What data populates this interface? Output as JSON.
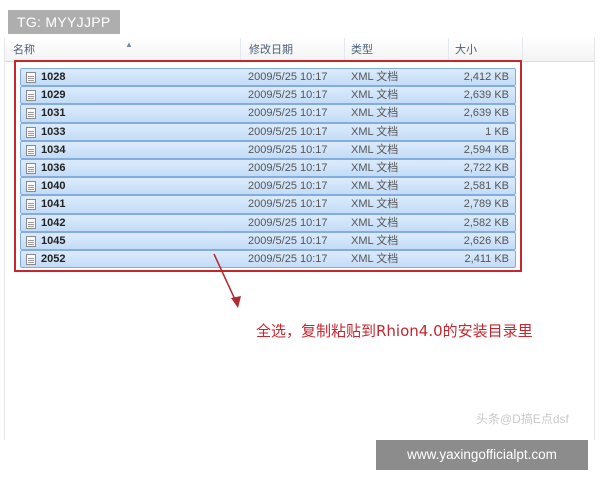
{
  "watermarks": {
    "top_left": "TG: MYYJJPP",
    "bottom_right": "www.yaxingofficialpt.com",
    "credit": "头条@D搞E点dsf"
  },
  "columns": {
    "name": "名称",
    "date": "修改日期",
    "type": "类型",
    "size": "大小"
  },
  "files": [
    {
      "name": "1028",
      "date": "2009/5/25 10:17",
      "type": "XML 文档",
      "size": "2,412 KB"
    },
    {
      "name": "1029",
      "date": "2009/5/25 10:17",
      "type": "XML 文档",
      "size": "2,639 KB"
    },
    {
      "name": "1031",
      "date": "2009/5/25 10:17",
      "type": "XML 文档",
      "size": "2,639 KB"
    },
    {
      "name": "1033",
      "date": "2009/5/25 10:17",
      "type": "XML 文档",
      "size": "1 KB"
    },
    {
      "name": "1034",
      "date": "2009/5/25 10:17",
      "type": "XML 文档",
      "size": "2,594 KB"
    },
    {
      "name": "1036",
      "date": "2009/5/25 10:17",
      "type": "XML 文档",
      "size": "2,722 KB"
    },
    {
      "name": "1040",
      "date": "2009/5/25 10:17",
      "type": "XML 文档",
      "size": "2,581 KB"
    },
    {
      "name": "1041",
      "date": "2009/5/25 10:17",
      "type": "XML 文档",
      "size": "2,789 KB"
    },
    {
      "name": "1042",
      "date": "2009/5/25 10:17",
      "type": "XML 文档",
      "size": "2,582 KB"
    },
    {
      "name": "1045",
      "date": "2009/5/25 10:17",
      "type": "XML 文档",
      "size": "2,626 KB"
    },
    {
      "name": "2052",
      "date": "2009/5/25 10:17",
      "type": "XML 文档",
      "size": "2,411 KB"
    }
  ],
  "annotation": "全选，复制粘贴到Rhion4.0的安装目录里",
  "icons": {
    "file": "xml-file-icon",
    "sort": "sort-up-icon",
    "arrow": "annotation-arrow-icon"
  },
  "colors": {
    "selection_border": "#c6262e",
    "row_highlight": "#c3dcf7",
    "annotation_text": "#c6262e"
  }
}
